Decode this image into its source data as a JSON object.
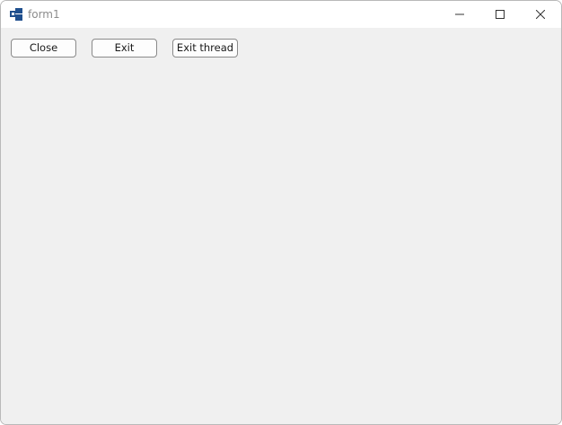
{
  "window": {
    "title": "form1",
    "icon": "app-window-icon",
    "controls": [
      "minimize-icon",
      "maximize-icon",
      "close-icon"
    ]
  },
  "buttons": {
    "close_label": "Close",
    "exit_label": "Exit",
    "exit_thread_label": "Exit thread"
  },
  "colors": {
    "titlebar": "#ffffff",
    "client": "#f0f0f0",
    "icon_blue": "#1f4f8e",
    "button_border": "#8a8a8a"
  }
}
